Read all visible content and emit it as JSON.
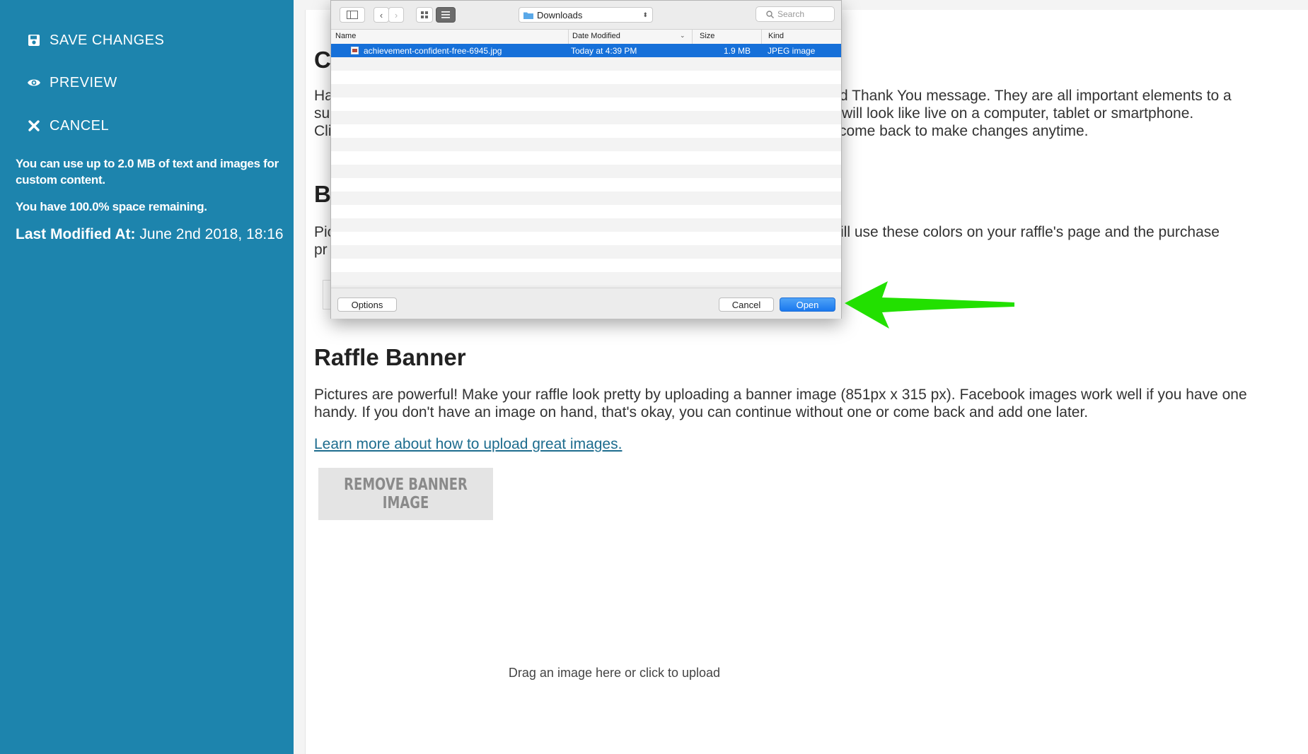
{
  "sidebar": {
    "save_label": "SAVE CHANGES",
    "preview_label": "PREVIEW",
    "cancel_label": "CANCEL",
    "usage_text": "You can use up to 2.0 MB of text and images for custom content.",
    "remaining_text": "You have 100.0% space remaining.",
    "last_modified_label": "Last Modified At:",
    "last_modified_value": "June 2nd 2018, 18:16"
  },
  "main": {
    "section1_heading_partial": "C",
    "section1_line1_left": "Ha",
    "section1_line1_right": "d Thank You message. They are all important elements to a",
    "section1_line2_left": "su",
    "section1_line2_right": "will look like live on a computer, tablet or smartphone.",
    "section1_line3_left": "Cli",
    "section1_line3_right": "come back to make changes anytime.",
    "section2_heading_partial": "B",
    "section2_line1_left": "Pic",
    "section2_line1_right": "ill use these colors on your raffle's page and the purchase",
    "section2_line2_left": "pr",
    "banner_heading": "Raffle Banner",
    "banner_text": "Pictures are powerful! Make your raffle look pretty by uploading a banner image (851px x 315 px). Facebook images work well if you have one handy. If you don't have an image on hand, that's okay, you can continue without one or come back and add one later.",
    "learn_more_link": "Learn more about how to upload great images.",
    "remove_banner_label": "REMOVE BANNER IMAGE",
    "drop_text": "Drag an image here or click to upload"
  },
  "dialog": {
    "folder": "Downloads",
    "search_placeholder": "Search",
    "columns": [
      "Name",
      "Date Modified",
      "Size",
      "Kind"
    ],
    "file": {
      "name": "achievement-confident-free-6945.jpg",
      "date": "Today at 4:39 PM",
      "size": "1.9 MB",
      "kind": "JPEG image"
    },
    "options_label": "Options",
    "cancel_label": "Cancel",
    "open_label": "Open"
  },
  "colors": {
    "sidebar_bg": "#1d84ad",
    "selection": "#1670d9",
    "arrow": "#22e000"
  }
}
